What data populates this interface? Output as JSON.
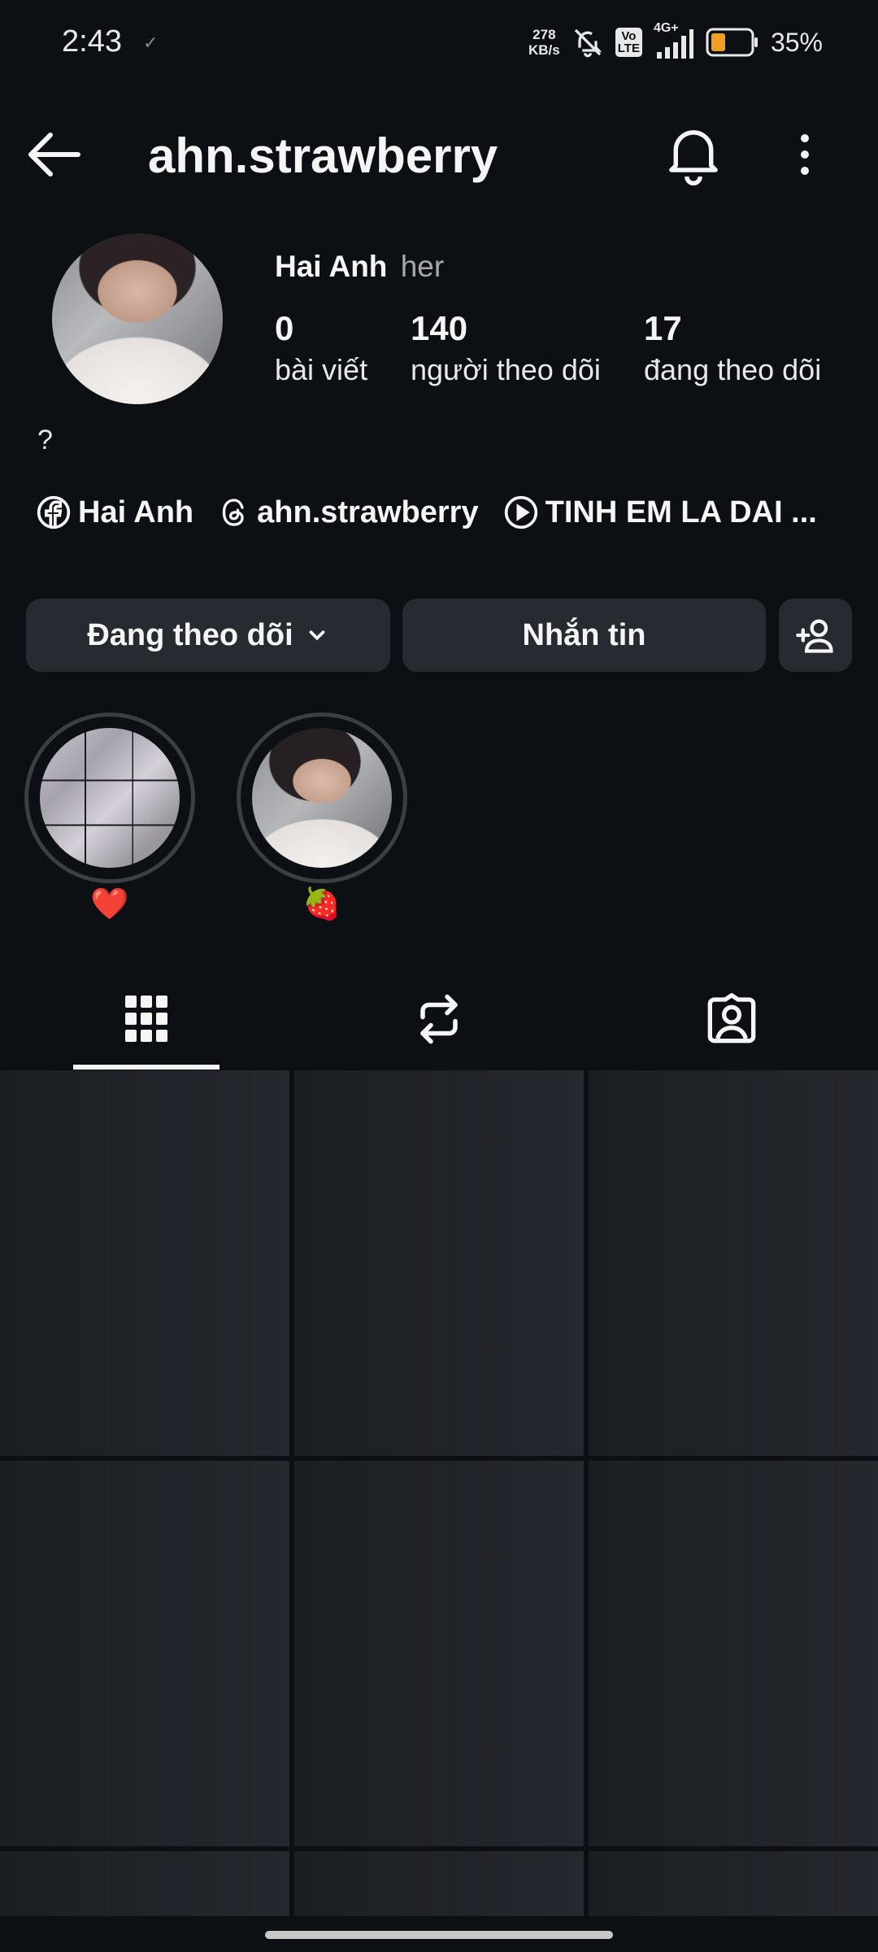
{
  "status_bar": {
    "time": "2:43",
    "net_speed_value": "278",
    "net_speed_unit": "KB/s",
    "volte_line1": "Vo",
    "volte_line2": "LTE",
    "network": "4G+",
    "battery_percent": "35%"
  },
  "header": {
    "username": "ahn.strawberry"
  },
  "profile": {
    "display_name": "Hai Anh",
    "pronouns": "her",
    "stats": [
      {
        "value": "0",
        "label": "bài viết"
      },
      {
        "value": "140",
        "label": "người theo dõi"
      },
      {
        "value": "17",
        "label": "đang theo dõi"
      }
    ],
    "bio": "?",
    "links": [
      {
        "icon": "facebook-icon",
        "label": "Hai Anh"
      },
      {
        "icon": "threads-icon",
        "label": "ahn.strawberry"
      },
      {
        "icon": "play-icon",
        "label": "TINH EM LA DAI ..."
      }
    ]
  },
  "actions": {
    "following_label": "Đang theo dõi",
    "message_label": "Nhắn tin"
  },
  "highlights": [
    {
      "label": "❤️"
    },
    {
      "label": "🍓"
    }
  ],
  "tabs": [
    "grid-icon",
    "repost-icon",
    "tagged-icon"
  ],
  "colors": {
    "background": "#0c0f14",
    "button": "#262a31",
    "text": "#f5f5f5",
    "muted": "#a8a8a8"
  }
}
